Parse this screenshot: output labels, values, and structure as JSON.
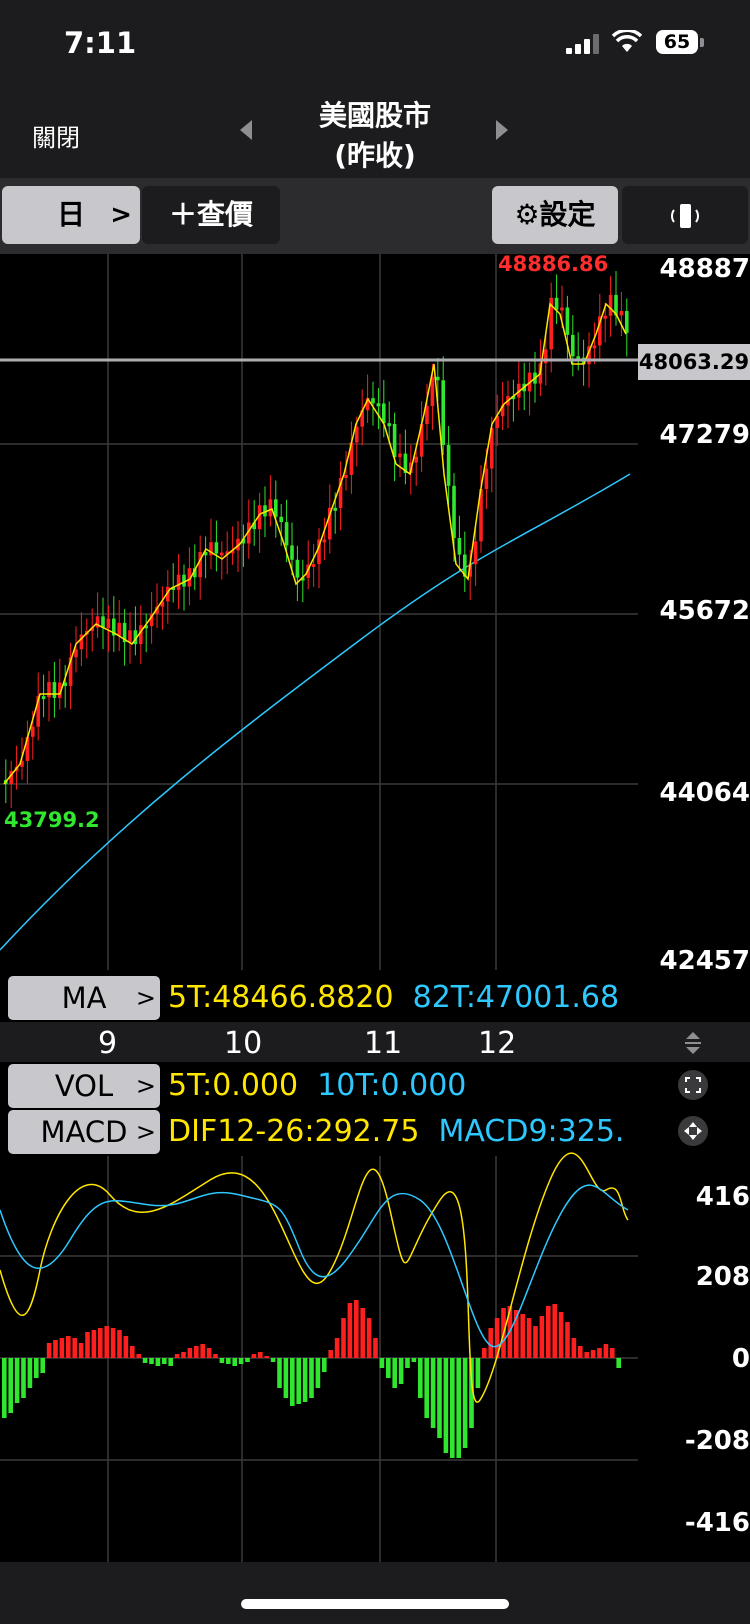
{
  "status": {
    "time": "7:11",
    "battery": "65"
  },
  "nav": {
    "close_label": "關閉",
    "title_line1": "美國股市",
    "title_line2": "(昨收)"
  },
  "toolbar": {
    "period_label": "日",
    "quote_label": "＋查價",
    "settings_label": "設定"
  },
  "price_chart": {
    "high_label": "48886.86",
    "low_label": "43799.2",
    "current_price": "48063.29",
    "y_labels": [
      "48887",
      "47279",
      "45672",
      "44064",
      "42457"
    ]
  },
  "ma": {
    "button": "MA",
    "ma5": "5T:48466.8820",
    "ma82": "82T:47001.68"
  },
  "x_labels": [
    "9",
    "10",
    "11",
    "12"
  ],
  "vol": {
    "button": "VOL",
    "v5": "5T:0.000",
    "v10": "10T:0.000"
  },
  "macd": {
    "button": "MACD",
    "dif": "DIF12-26:292.75",
    "macd9": "MACD9:325.",
    "y_labels": [
      "416",
      "208",
      "0",
      "-208",
      "-416"
    ]
  },
  "colors": {
    "up": "#ff1f1f",
    "down": "#31e62e",
    "ma5": "#ffe600",
    "ma82": "#2ec8ff"
  }
}
